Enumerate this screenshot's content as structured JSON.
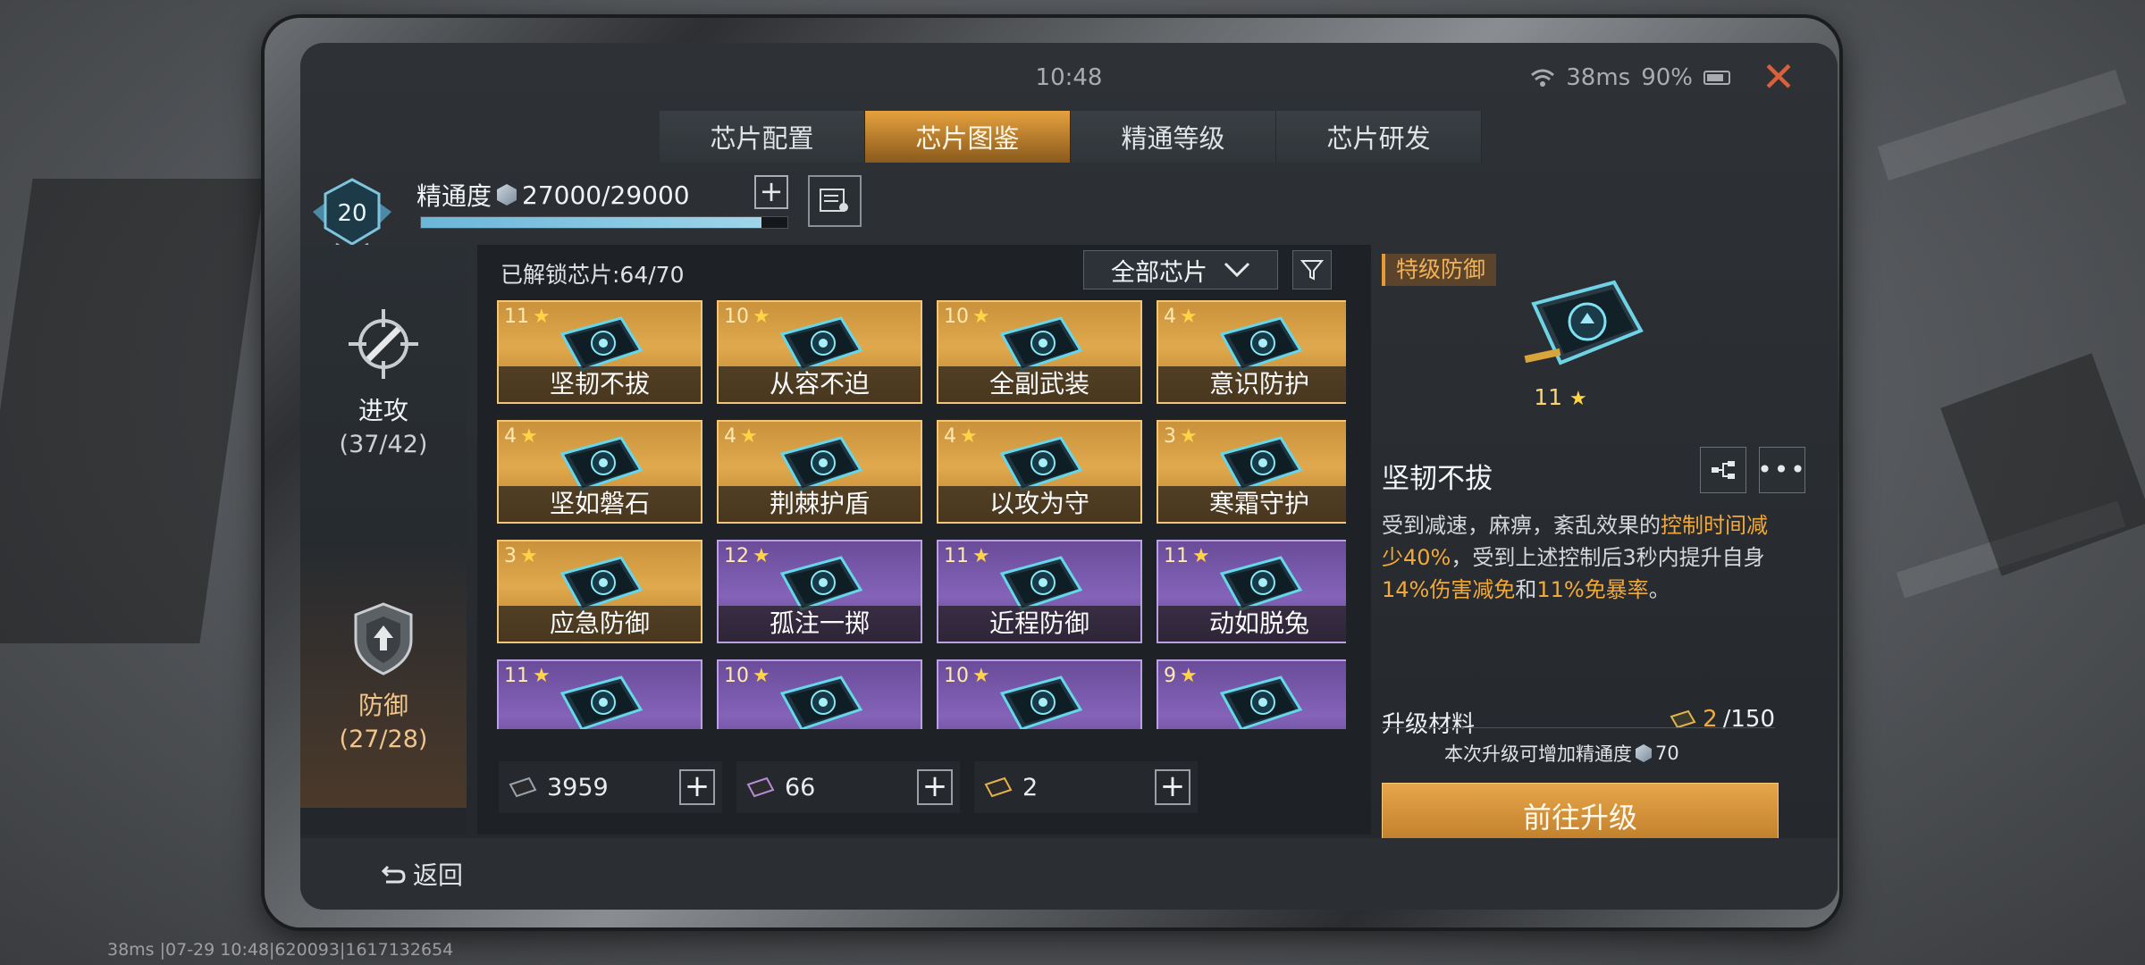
{
  "status": {
    "time": "10:48",
    "ping": "38ms",
    "battery": "90%"
  },
  "tabs": [
    {
      "label": "芯片配置",
      "active": false
    },
    {
      "label": "芯片图鉴",
      "active": true
    },
    {
      "label": "精通等级",
      "active": false
    },
    {
      "label": "芯片研发",
      "active": false
    }
  ],
  "header": {
    "level": "20",
    "mastery_label": "精通度",
    "mastery_value": "27000/29000",
    "mastery_progress": 0.93
  },
  "nav": [
    {
      "label": "进攻",
      "count": "(37/42)",
      "icon": "crosshair-icon"
    },
    {
      "label": "防御",
      "count": "(27/28)",
      "icon": "shield-icon"
    }
  ],
  "grid": {
    "unlocked": "已解锁芯片:64/70",
    "filter": "全部芯片",
    "cards": [
      {
        "stars": "11",
        "name": "坚韧不拔",
        "rarity": "gold"
      },
      {
        "stars": "10",
        "name": "从容不迫",
        "rarity": "gold"
      },
      {
        "stars": "10",
        "name": "全副武装",
        "rarity": "gold"
      },
      {
        "stars": "4",
        "name": "意识防护",
        "rarity": "gold"
      },
      {
        "stars": "4",
        "name": "坚如磐石",
        "rarity": "gold"
      },
      {
        "stars": "4",
        "name": "荆棘护盾",
        "rarity": "gold"
      },
      {
        "stars": "4",
        "name": "以攻为守",
        "rarity": "gold"
      },
      {
        "stars": "3",
        "name": "寒霜守护",
        "rarity": "gold"
      },
      {
        "stars": "3",
        "name": "应急防御",
        "rarity": "gold"
      },
      {
        "stars": "12",
        "name": "孤注一掷",
        "rarity": "purple"
      },
      {
        "stars": "11",
        "name": "近程防御",
        "rarity": "purple"
      },
      {
        "stars": "11",
        "name": "动如脱兔",
        "rarity": "purple"
      },
      {
        "stars": "11",
        "name": "",
        "rarity": "purple"
      },
      {
        "stars": "10",
        "name": "",
        "rarity": "purple"
      },
      {
        "stars": "10",
        "name": "",
        "rarity": "purple"
      },
      {
        "stars": "9",
        "name": "",
        "rarity": "purple"
      }
    ]
  },
  "resources": [
    {
      "value": "3959",
      "color": "#9aa3ad"
    },
    {
      "value": "66",
      "color": "#b78ad6"
    },
    {
      "value": "2",
      "color": "#e3b24a"
    }
  ],
  "detail": {
    "grade": "特级防御",
    "stars": "11",
    "name": "坚韧不拔",
    "desc_parts": [
      {
        "text": "受到减速，麻痹，紊乱效果的",
        "hl": false
      },
      {
        "text": "控制时间减少40%",
        "hl": true
      },
      {
        "text": "，受到上述控制后3秒内提升自身",
        "hl": false
      },
      {
        "text": "14%伤害减免",
        "hl": true
      },
      {
        "text": "和",
        "hl": false
      },
      {
        "text": "11%免暴率",
        "hl": true
      },
      {
        "text": "。",
        "hl": false
      }
    ],
    "material_label": "升级材料",
    "material_have": "2",
    "material_need": "/150",
    "hint_text": "本次升级可增加精通度",
    "hint_value": "70",
    "upgrade_button": "前往升级"
  },
  "footer": {
    "back": "返回"
  },
  "bottom_info": "38ms  |07-29 10:48|620093|1617132654"
}
